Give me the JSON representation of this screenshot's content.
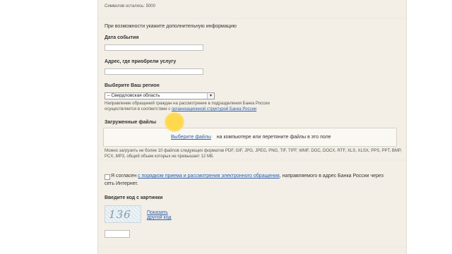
{
  "form": {
    "chars_left": "Символов осталось: 5000",
    "additional_info_prompt": "При возможности укажите дополнительную информацию",
    "event_date_label": "Дата события",
    "address_label": "Адрес, где приобрели услугу",
    "region_label": "Выберите Ваш регион",
    "region_selected": "– Свердловская область",
    "region_note_1": "Направление обращений граждан на рассмотрение в подразделения Банка России",
    "region_note_2_prefix": "осуществляется в соответствии с ",
    "region_note_2_link": "организационной структурой Банка России",
    "uploaded_files_label": "Загруженные файлы",
    "choose_files_link": "Выберите файлы",
    "dropzone_text": "на компьютере или перетяните файлы в это поле",
    "upload_note_1": "Можно загрузить не более 10 файлов следующих форматов PDF, GIF, JPG, JPEG, PNG, TIF, TIFF, WMF, DOC, DOCX, RTF, XLS, XLSX, PPS, PPT, BMP,",
    "upload_note_2": "PCX, MP3, общий объем которых не превышает 12 МБ",
    "agree_prefix": "Я согласен ",
    "agree_link": "с порядком приема и рассмотрения электронного обращения",
    "agree_suffix_1": ", направляемого в адрес Банка России через",
    "agree_suffix_2": "сеть Интернет.",
    "captcha_label": "Введите код с картинки",
    "captcha_text": "136",
    "show_other_code_1": "Показать",
    "show_other_code_2": "другой код"
  },
  "colors": {
    "panel_bg": "#f3efe6",
    "link": "#2a5db0",
    "highlight": "#ffd84d"
  }
}
